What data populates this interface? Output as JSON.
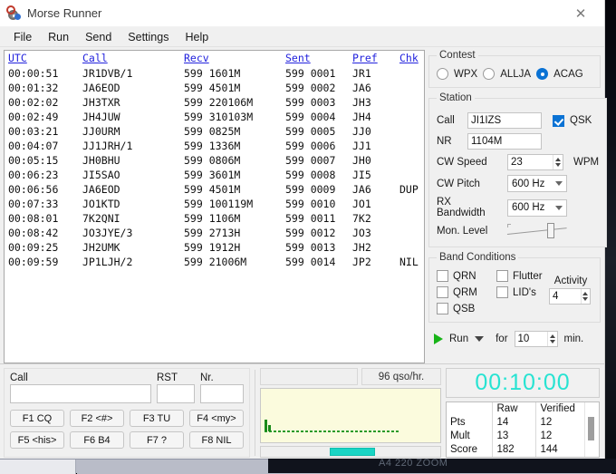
{
  "window": {
    "title": "Morse Runner",
    "icon": "morse-runner-icon",
    "close_label": "✕"
  },
  "menu": {
    "items": [
      {
        "label": "File"
      },
      {
        "label": "Run"
      },
      {
        "label": "Send"
      },
      {
        "label": "Settings"
      },
      {
        "label": "Help"
      }
    ]
  },
  "qso_table": {
    "headers": [
      "UTC",
      "Call",
      "Recv",
      "Sent",
      "Pref",
      "Chk"
    ],
    "rows": [
      {
        "utc": "00:00:51",
        "call": "JR1DVB/1",
        "recv": "599 1601M",
        "sent": "599 0001",
        "pref": "JR1",
        "chk": ""
      },
      {
        "utc": "00:01:32",
        "call": "JA6EOD",
        "recv": "599 4501M",
        "sent": "599 0002",
        "pref": "JA6",
        "chk": ""
      },
      {
        "utc": "00:02:02",
        "call": "JH3TXR",
        "recv": "599 220106M",
        "sent": "599 0003",
        "pref": "JH3",
        "chk": ""
      },
      {
        "utc": "00:02:49",
        "call": "JH4JUW",
        "recv": "599 310103M",
        "sent": "599 0004",
        "pref": "JH4",
        "chk": ""
      },
      {
        "utc": "00:03:21",
        "call": "JJ0URM",
        "recv": "599 0825M",
        "sent": "599 0005",
        "pref": "JJ0",
        "chk": ""
      },
      {
        "utc": "00:04:07",
        "call": "JJ1JRH/1",
        "recv": "599 1336M",
        "sent": "599 0006",
        "pref": "JJ1",
        "chk": ""
      },
      {
        "utc": "00:05:15",
        "call": "JH0BHU",
        "recv": "599 0806M",
        "sent": "599 0007",
        "pref": "JH0",
        "chk": ""
      },
      {
        "utc": "00:06:23",
        "call": "JI5SAO",
        "recv": "599 3601M",
        "sent": "599 0008",
        "pref": "JI5",
        "chk": ""
      },
      {
        "utc": "00:06:56",
        "call": "JA6EOD",
        "recv": "599 4501M",
        "sent": "599 0009",
        "pref": "JA6",
        "chk": "DUP"
      },
      {
        "utc": "00:07:33",
        "call": "JO1KTD",
        "recv": "599 100119M",
        "sent": "599 0010",
        "pref": "JO1",
        "chk": ""
      },
      {
        "utc": "00:08:01",
        "call": "7K2QNI",
        "recv": "599 1106M",
        "sent": "599 0011",
        "pref": "7K2",
        "chk": ""
      },
      {
        "utc": "00:08:42",
        "call": "JO3JYE/3",
        "recv": "599 2713H",
        "sent": "599 0012",
        "pref": "JO3",
        "chk": ""
      },
      {
        "utc": "00:09:25",
        "call": "JH2UMK",
        "recv": "599 1912H",
        "sent": "599 0013",
        "pref": "JH2",
        "chk": ""
      },
      {
        "utc": "00:09:59",
        "call": "JP1LJH/2",
        "recv": "599 21006M",
        "sent": "599 0014",
        "pref": "JP2",
        "chk": "NIL"
      }
    ]
  },
  "contest": {
    "legend": "Contest",
    "options": [
      {
        "label": "WPX",
        "selected": false
      },
      {
        "label": "ALLJA",
        "selected": false
      },
      {
        "label": "ACAG",
        "selected": true
      }
    ]
  },
  "station": {
    "legend": "Station",
    "call_label": "Call",
    "call_value": "JI1IZS",
    "qsk_label": "QSK",
    "qsk_checked": true,
    "nr_label": "NR",
    "nr_value": "1104M",
    "cw_speed_label": "CW Speed",
    "cw_speed_value": "23",
    "wpm_label": "WPM",
    "cw_pitch_label": "CW Pitch",
    "cw_pitch_value": "600 Hz",
    "rx_bandwidth_label": "RX Bandwidth",
    "rx_bandwidth_value": "600 Hz",
    "mon_level_label": "Mon. Level"
  },
  "band_conditions": {
    "legend": "Band Conditions",
    "checks": [
      {
        "label": "QRN",
        "checked": false
      },
      {
        "label": "Flutter",
        "checked": false
      },
      {
        "label": "QRM",
        "checked": false
      },
      {
        "label": "LID's",
        "checked": false
      },
      {
        "label": "QSB",
        "checked": false
      }
    ],
    "activity_label": "Activity",
    "activity_value": "4"
  },
  "run_bar": {
    "play_icon": "play-icon",
    "run_label": "Run",
    "for_label": "for",
    "minutes_value": "10",
    "min_label": "min."
  },
  "entry": {
    "call_label": "Call",
    "call_value": "",
    "call_placeholder": "",
    "rst_label": "RST",
    "rst_value": "",
    "nr_label": "Nr.",
    "nr_value": "",
    "function_keys": [
      [
        {
          "label": "F1 CQ"
        },
        {
          "label": "F2 <#>"
        },
        {
          "label": "F3 TU"
        },
        {
          "label": "F4 <my>"
        }
      ],
      [
        {
          "label": "F5 <his>"
        },
        {
          "label": "F6 B4"
        },
        {
          "label": "F7 ?"
        },
        {
          "label": "F8 NIL"
        }
      ]
    ]
  },
  "status": {
    "message": "",
    "rate": "96  qso/hr."
  },
  "clock": {
    "value": "00:10:00",
    "color": "#27e3d2"
  },
  "score": {
    "headers": [
      "",
      "Raw",
      "Verified"
    ],
    "rows": [
      {
        "label": "Pts",
        "raw": "14",
        "verified": "12"
      },
      {
        "label": "Mult",
        "raw": "13",
        "verified": "12"
      },
      {
        "label": "Score",
        "raw": "182",
        "verified": "144"
      }
    ]
  },
  "desktop": {
    "behind_label": "A4 220 ZOOM"
  },
  "chart_data": {
    "type": "line",
    "title": "Receiver spectrum / signal activity",
    "xlabel": "",
    "ylabel": "",
    "x": [
      0,
      1,
      2,
      3,
      4,
      5,
      6,
      7,
      8,
      9,
      10,
      11,
      12,
      13,
      14,
      15,
      16,
      17,
      18,
      19,
      20
    ],
    "values": [
      0.1,
      0.32,
      0.04,
      0.02,
      0.02,
      0.02,
      0.02,
      0.02,
      0.02,
      0.02,
      0.02,
      0.02,
      0.02,
      0.02,
      0.02,
      0.02,
      0.02,
      0.02,
      0.02,
      0.02,
      0.0
    ],
    "ylim": [
      0,
      1
    ],
    "grid": false,
    "legend": "none",
    "series_color": "#1a8a1a",
    "background": "#fbfbdd"
  }
}
